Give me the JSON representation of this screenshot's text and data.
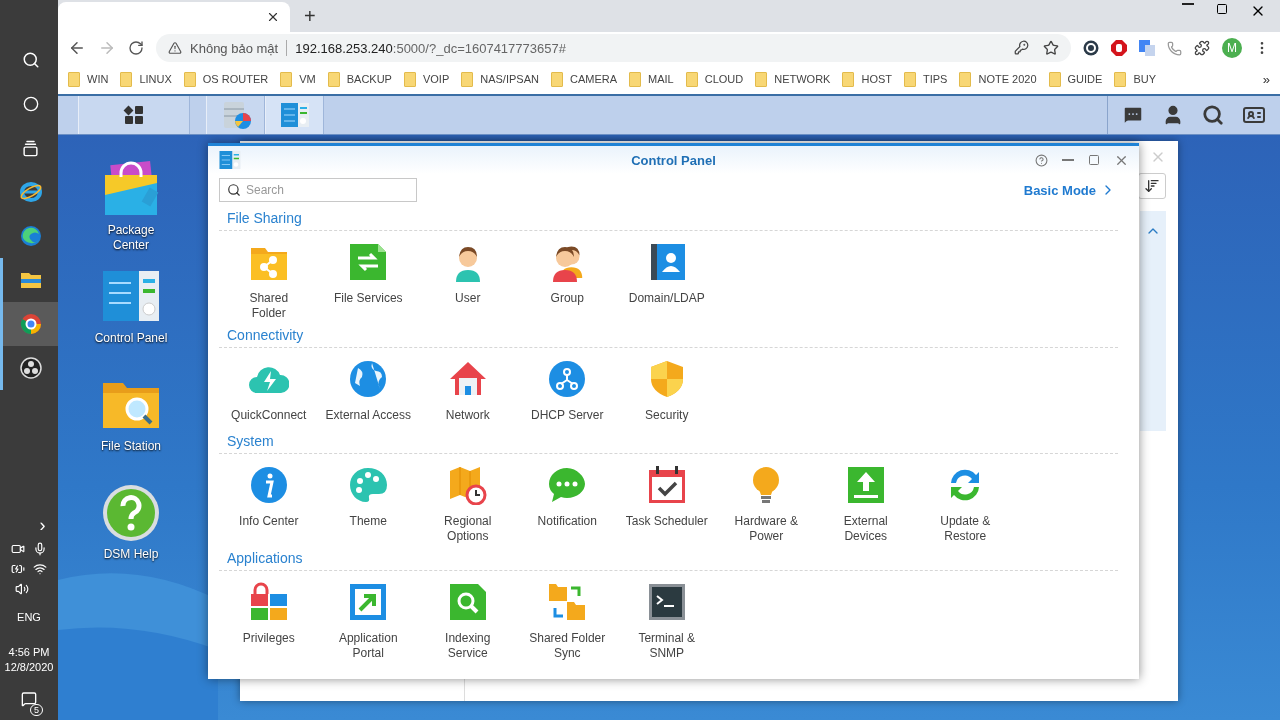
{
  "windows_taskbar": {
    "pinned": [
      {
        "selected": false
      },
      {
        "selected": false
      },
      {
        "selected": false
      },
      {
        "selected": true
      },
      {
        "selected": false
      }
    ],
    "expand": "›",
    "language": "ENG",
    "time": "4:56 PM",
    "date": "12/8/2020",
    "notifications": "5"
  },
  "browser": {
    "new_tab": "+",
    "security_warning": "Không bảo mật",
    "url_host": "192.168.253.240",
    "url_rest": ":5000/?_dc=1607417773657#",
    "profile_initial": "M",
    "bookmarks": [
      "WIN",
      "LINUX",
      "OS ROUTER",
      "VM",
      "BACKUP",
      "VOIP",
      "NAS/IPSAN",
      "CAMERA",
      "MAIL",
      "CLOUD",
      "NETWORK",
      "HOST",
      "TIPS",
      "NOTE 2020",
      "GUIDE",
      "BUY"
    ],
    "more_bookmarks": "»"
  },
  "dsm_taskbar": {
    "apps": [
      {
        "selected": false
      },
      {
        "selected": true
      }
    ]
  },
  "desktop_icons": [
    {
      "lines": [
        "Package",
        "Center"
      ]
    },
    {
      "lines": [
        "Control Panel"
      ]
    },
    {
      "lines": [
        "File Station"
      ]
    },
    {
      "lines": [
        "DSM Help"
      ]
    }
  ],
  "control_panel": {
    "title": "Control Panel",
    "search": {
      "placeholder": "Search"
    },
    "mode_link": "Basic Mode",
    "sections": [
      {
        "title": "File Sharing",
        "items": [
          {
            "lines": [
              "Shared",
              "Folder"
            ]
          },
          {
            "lines": [
              "File Services"
            ]
          },
          {
            "lines": [
              "User"
            ]
          },
          {
            "lines": [
              "Group"
            ]
          },
          {
            "lines": [
              "Domain/LDAP"
            ]
          }
        ]
      },
      {
        "title": "Connectivity",
        "items": [
          {
            "lines": [
              "QuickConnect"
            ]
          },
          {
            "lines": [
              "External Access"
            ]
          },
          {
            "lines": [
              "Network"
            ]
          },
          {
            "lines": [
              "DHCP Server"
            ]
          },
          {
            "lines": [
              "Security"
            ]
          }
        ]
      },
      {
        "title": "System",
        "items": [
          {
            "lines": [
              "Info Center"
            ]
          },
          {
            "lines": [
              "Theme"
            ]
          },
          {
            "lines": [
              "Regional",
              "Options"
            ]
          },
          {
            "lines": [
              "Notification"
            ]
          },
          {
            "lines": [
              "Task Scheduler"
            ]
          },
          {
            "lines": [
              "Hardware &",
              "Power"
            ]
          },
          {
            "lines": [
              "External",
              "Devices"
            ]
          },
          {
            "lines": [
              "Update &",
              "Restore"
            ]
          }
        ]
      },
      {
        "title": "Applications",
        "items": [
          {
            "lines": [
              "Privileges"
            ]
          },
          {
            "lines": [
              "Application",
              "Portal"
            ]
          },
          {
            "lines": [
              "Indexing",
              "Service"
            ]
          },
          {
            "lines": [
              "Shared Folder",
              "Sync"
            ]
          },
          {
            "lines": [
              "Terminal &",
              "SNMP"
            ]
          }
        ]
      }
    ]
  }
}
